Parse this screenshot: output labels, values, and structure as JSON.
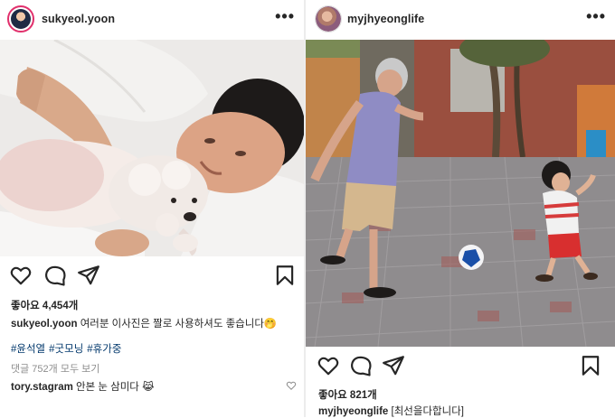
{
  "left_post": {
    "username": "sukyeol.yoon",
    "more": "•••",
    "likes": "좋아요 4,454개",
    "caption_user": "sukyeol.yoon",
    "caption_text": "여러분 이사진은 짤로 사용하셔도 좋습니다🤭",
    "hashtags": [
      "#윤석열",
      "#굿모닝",
      "#휴가중"
    ],
    "view_comments": "댓글 752개 모두 보기",
    "comment_user": "tory.stagram",
    "comment_text": "안본 눈 삼미다 😹",
    "icons": [
      "heart-icon",
      "comment-icon",
      "share-icon",
      "bookmark-icon"
    ]
  },
  "right_post": {
    "username": "myjhyeonglife",
    "more": "•••",
    "likes": "좋아요 821개",
    "caption_user": "myjhyeonglife",
    "caption_text": "[최선을다합니다]",
    "icons": [
      "heart-icon",
      "comment-icon",
      "share-icon",
      "bookmark-icon"
    ]
  },
  "colors": {
    "text": "#262626",
    "hashtag": "#00376b",
    "muted": "#8e8e8e",
    "story_ring": "#e1306c"
  }
}
